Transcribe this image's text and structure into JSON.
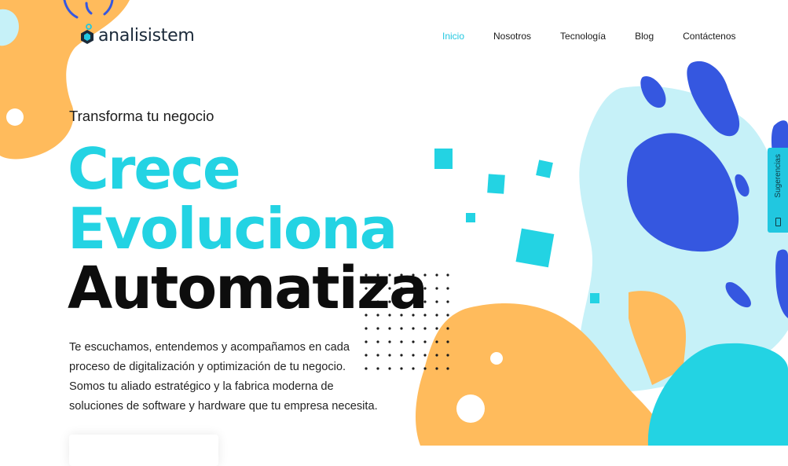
{
  "brand": {
    "name": "analisistem"
  },
  "nav": {
    "items": [
      {
        "label": "Inicio",
        "active": true
      },
      {
        "label": "Nosotros"
      },
      {
        "label": "Tecnología"
      },
      {
        "label": "Blog"
      },
      {
        "label": "Contáctenos"
      }
    ]
  },
  "hero": {
    "tagline": "Transforma tu negocio",
    "headline": [
      "Crece",
      "Evoluciona",
      "Automatiza"
    ],
    "description": "Te escuchamos, entendemos y acompañamos en cada proceso de digitalización y optimización de tu negocio. Somos tu aliado estratégico y la fabrica moderna de soluciones de software y hardware que tu empresa necesita."
  },
  "feedback_tab": {
    "label": "Sugerencias",
    "icon": "feedback-icon"
  },
  "colors": {
    "accent_cyan": "#23d3e3",
    "nav_active": "#21c7e0",
    "blob_orange": "#ffbb5c",
    "blob_light_blue": "#c6f1f8",
    "blob_dark_blue": "#3557e0",
    "dark_text": "#0d0d0d"
  }
}
